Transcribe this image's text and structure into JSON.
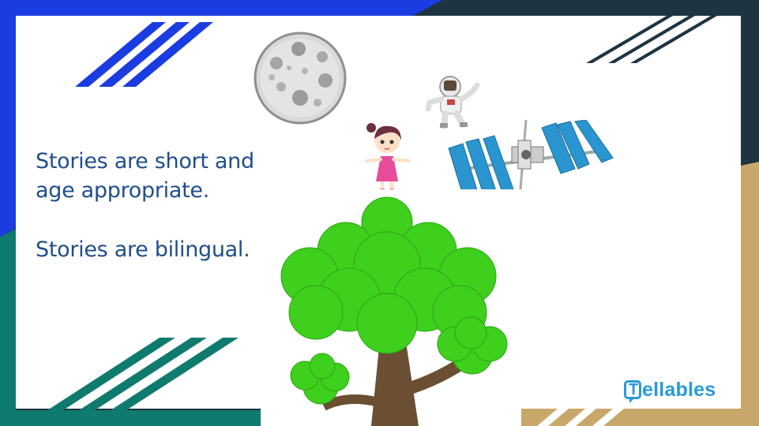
{
  "slide": {
    "line1": "Stories are short and",
    "line2": "age appropriate.",
    "line3": "Stories are bilingual."
  },
  "logo": {
    "mark_letter": "T",
    "text": "ellables"
  },
  "colors": {
    "accent_blue": "#1a3ce0",
    "teal": "#0f7a6e",
    "dark_navy": "#1e3441",
    "tan": "#c8a86a",
    "text_blue": "#1f4e8c",
    "logo_blue": "#2a9ad6"
  },
  "illustrations": [
    "moon",
    "astronaut",
    "space-station",
    "girl",
    "tree"
  ]
}
